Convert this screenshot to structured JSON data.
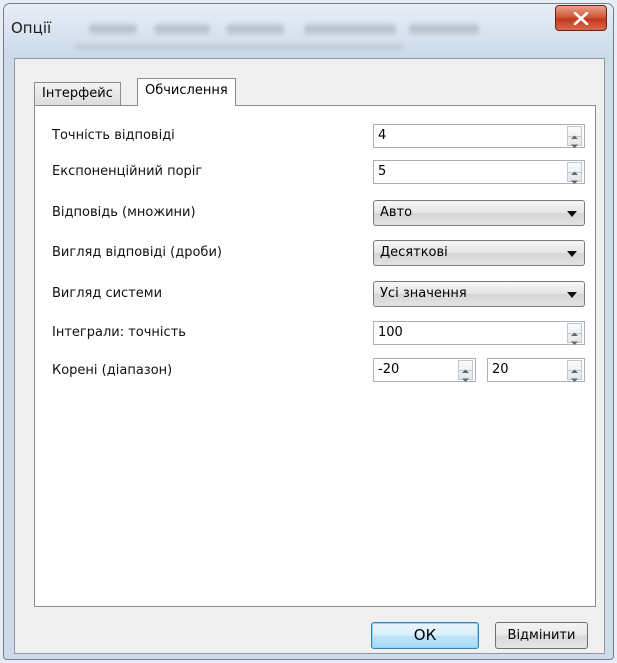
{
  "window": {
    "title": "Опції",
    "close_icon": "close-icon"
  },
  "tabs": [
    {
      "label": "Інтерфейс",
      "active": false
    },
    {
      "label": "Обчислення",
      "active": true
    }
  ],
  "fields": {
    "precision": {
      "label": "Точність відповіді",
      "value": "4"
    },
    "exp_threshold": {
      "label": "Експоненційний поріг",
      "value": "5"
    },
    "answer_sets": {
      "label": "Відповідь (множини)",
      "value": "Авто"
    },
    "answer_fractions": {
      "label": "Вигляд відповіді (дроби)",
      "value": "Десяткові"
    },
    "system_view": {
      "label": "Вигляд системи",
      "value": "Усі значення"
    },
    "integral_precision": {
      "label": "Інтеграли: точність",
      "value": "100"
    },
    "roots_range": {
      "label": "Корені (діапазон)",
      "min": "-20",
      "max": "20"
    }
  },
  "buttons": {
    "ok": "ОК",
    "cancel": "Відмінити"
  },
  "colors": {
    "close_button": "#c0391f",
    "ok_button": "#bee6fd",
    "frame": "#cfdbea"
  }
}
